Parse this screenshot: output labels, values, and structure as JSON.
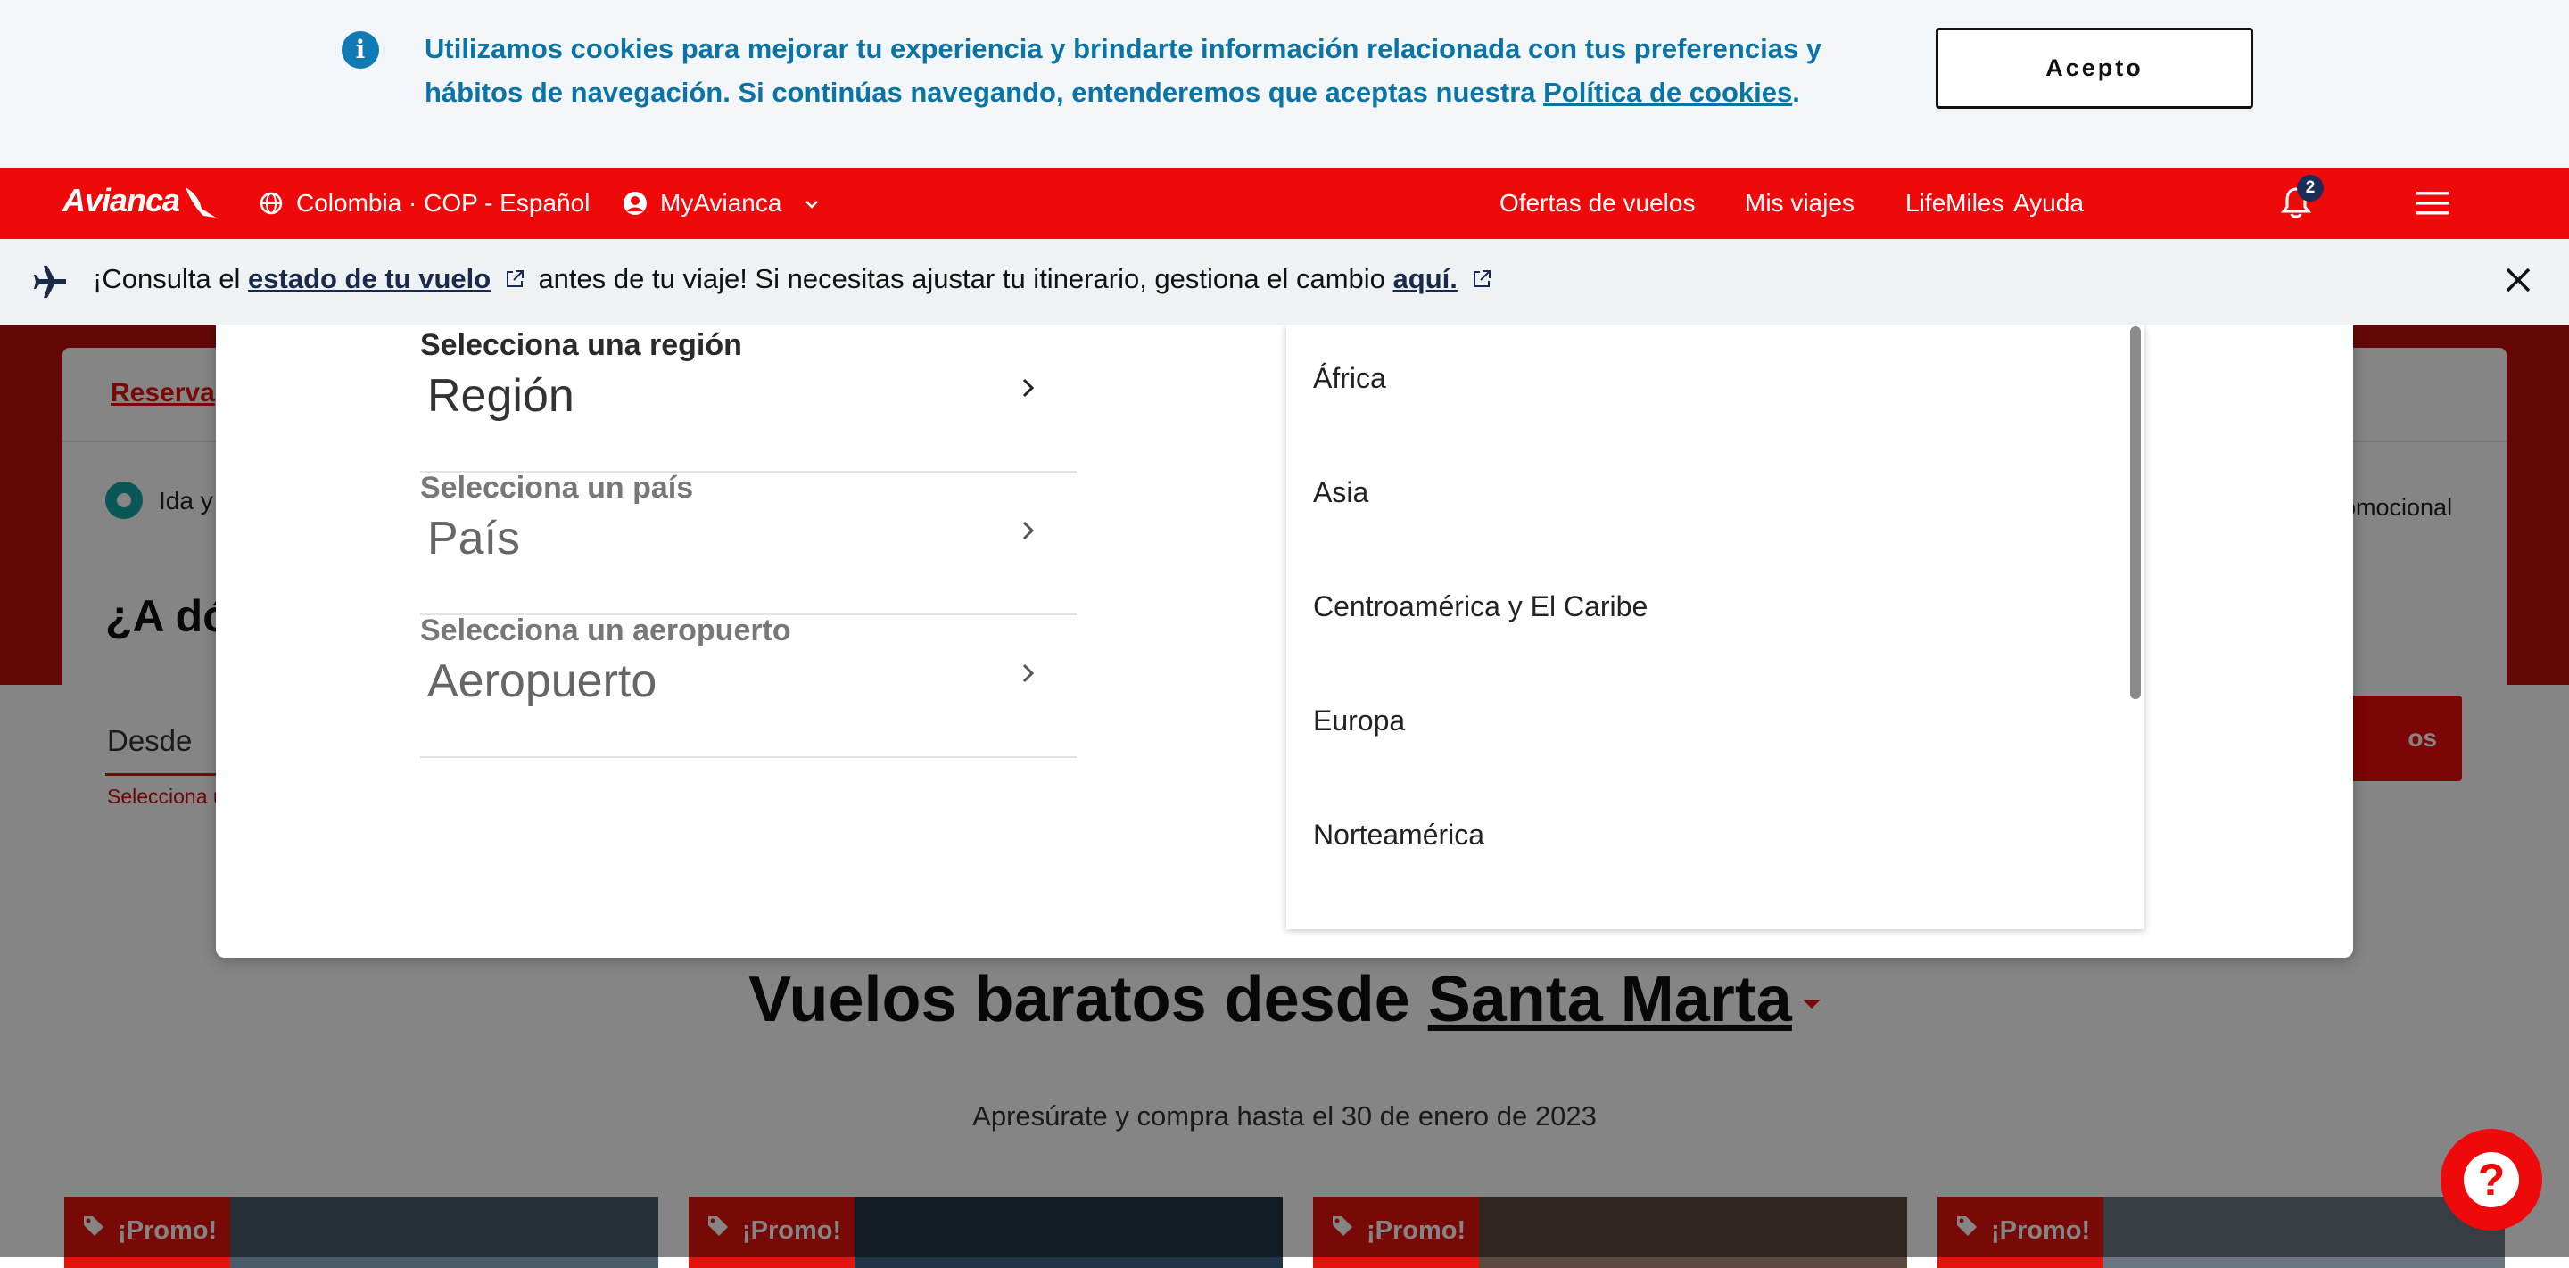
{
  "cookie_banner": {
    "text": "Utilizamos cookies para mejorar tu experiencia y brindarte información relacionada con tus preferencias y hábitos de navegación. Si continúas navegando, entenderemos que aceptas nuestra ",
    "link": "Política de cookies",
    "end": ".",
    "accept_label": "Acepto"
  },
  "nav": {
    "logo": "Avianca",
    "locale": "Colombia · COP - Español",
    "account": "MyAvianca",
    "links": [
      "Ofertas de vuelos",
      "Mis viajes",
      "LifeMiles",
      "Ayuda"
    ],
    "notification_count": "2"
  },
  "status_bar": {
    "prefix": "¡Consulta el ",
    "link1": "estado de tu vuelo",
    "middle": " antes de tu viaje! Si necesitas ajustar tu itinerario, gestiona el cambio ",
    "link2": "aquí."
  },
  "booking": {
    "tab": "Reserva",
    "trip_type": "Ida y",
    "question": "¿A dó",
    "from_label": "Desde",
    "from_error": "Selecciona u",
    "promo_label": "omocional",
    "search_label": "os"
  },
  "modal": {
    "fields": [
      {
        "label": "Selecciona una región",
        "value": "Región"
      },
      {
        "label": "Selecciona un país",
        "value": "País"
      },
      {
        "label": "Selecciona un aeropuerto",
        "value": "Aeropuerto"
      }
    ],
    "regions": [
      "África",
      "Asia",
      "Centroamérica y El Caribe",
      "Europa",
      "Norteamérica"
    ]
  },
  "section": {
    "title_prefix": "Vuelos baratos desde ",
    "city": "Santa Marta",
    "subtitle": "Apresúrate y compra hasta el 30 de enero de 2023",
    "promo_tag": "¡Promo!"
  },
  "colors": {
    "brand_red": "#ee0a0a",
    "cookie_text": "#0b74a5",
    "radio_teal": "#13a7a7"
  }
}
